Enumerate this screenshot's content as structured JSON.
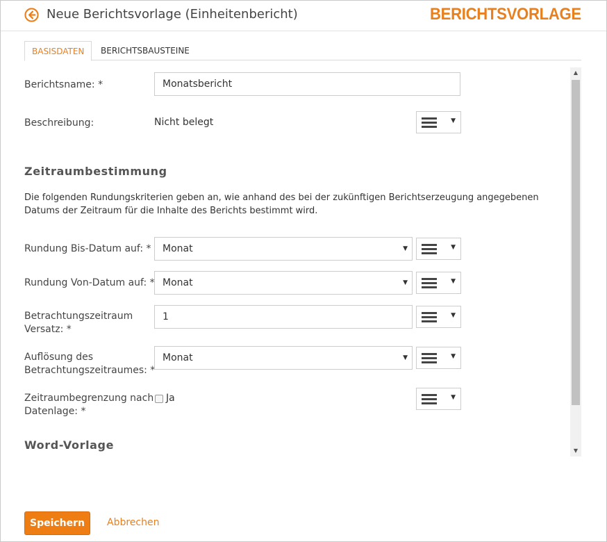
{
  "header": {
    "title": "Neue Berichtsvorlage (Einheitenbericht)",
    "brand": "BERICHTSVORLAGE",
    "accent_color": "#e8801e",
    "back_icon": "arrow-circle-left"
  },
  "tabs": [
    {
      "label": "BASISDATEN",
      "active": true
    },
    {
      "label": "BERICHTSBAUSTEINE",
      "active": false
    }
  ],
  "form": {
    "report_name": {
      "label": "Berichtsname: *",
      "value": "Monatsbericht"
    },
    "description": {
      "label": "Beschreibung:",
      "value": "Nicht belegt"
    },
    "timeframe_section": {
      "heading": "Zeitraumbestimmung",
      "text": "Die folgenden Rundungskriterien geben an, wie anhand des bei der zukünftigen Berichtserzeugung angegebenen Datums der Zeitraum für die Inhalte des Berichts bestimmt wird."
    },
    "round_to": {
      "label": "Rundung Bis-Datum auf: *",
      "value": "Monat"
    },
    "round_from": {
      "label": "Rundung Von-Datum auf: *",
      "value": "Monat"
    },
    "period_offset": {
      "label_line1": "Betrachtungszeitraum",
      "label_line2": "Versatz: *",
      "value": "1"
    },
    "period_resolution": {
      "label_line1": "Auflösung des",
      "label_line2": "Betrachtungszeitraumes: *",
      "value": "Monat"
    },
    "data_limit": {
      "label_line1": "Zeitraumbegrenzung nach",
      "label_line2": "Datenlage: *",
      "checkbox_label": "Ja",
      "checked": false
    },
    "word_template_heading": "Word-Vorlage"
  },
  "footer": {
    "save_label": "Speichern",
    "cancel_label": "Abbrechen"
  }
}
